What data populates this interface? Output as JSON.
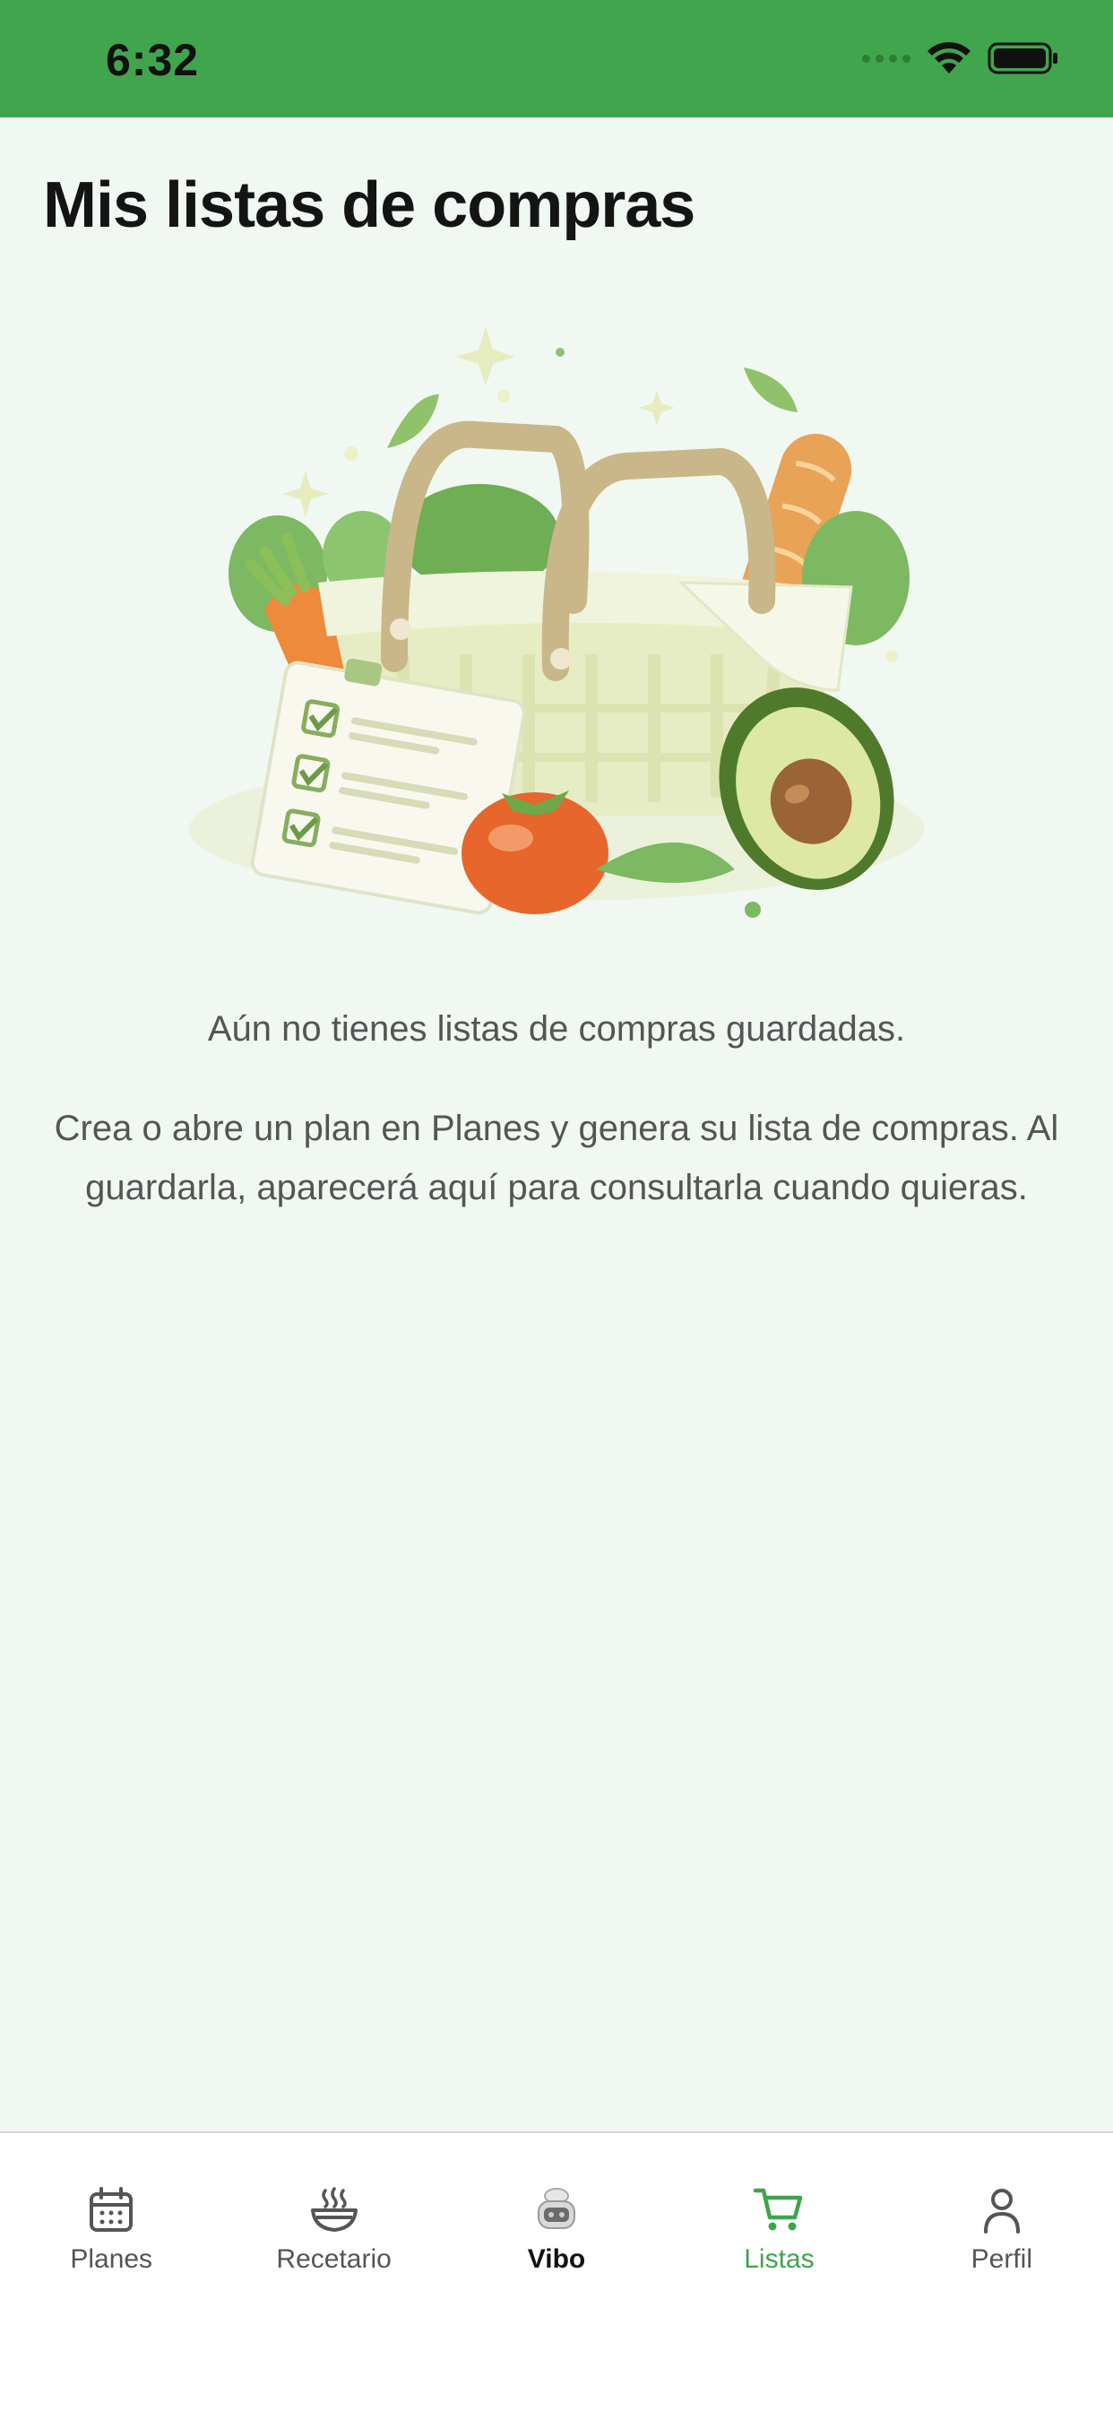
{
  "status_bar": {
    "time": "6:32",
    "icons": [
      "signal-icon",
      "wifi-icon",
      "battery-icon"
    ],
    "background": "#40a54d"
  },
  "header": {
    "title": "Mis listas de compras"
  },
  "empty_state": {
    "illustration": "shopping-basket-illustration",
    "title": "Aún no tienes listas de compras guardadas.",
    "description": "Crea o abre un plan en Planes y genera su lista de compras. Al guardarla, aparecerá aquí para consultarla cuando quieras."
  },
  "tab_bar": {
    "items": [
      {
        "label": "Planes",
        "icon": "calendar-icon"
      },
      {
        "label": "Recetario",
        "icon": "steaming-bowl-icon"
      },
      {
        "label": "Vibo",
        "icon": "chef-bot-icon"
      },
      {
        "label": "Listas",
        "icon": "cart-icon",
        "active": true
      },
      {
        "label": "Perfil",
        "icon": "person-icon"
      }
    ],
    "active_color": "#3ea44c"
  }
}
